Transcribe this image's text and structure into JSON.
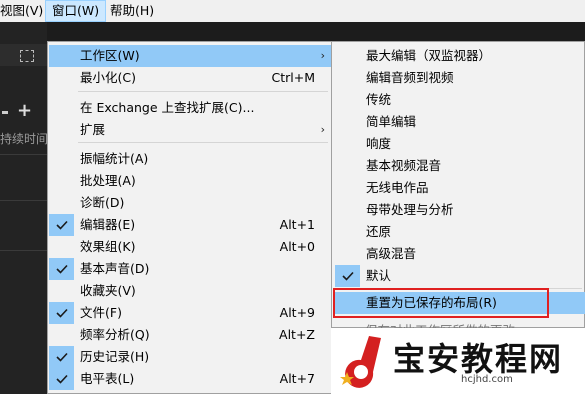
{
  "menubar": {
    "view": "视图(V)",
    "window": "窗口(W)",
    "help": "帮助(H)"
  },
  "background": {
    "duration_label": "持续时间"
  },
  "window_menu": {
    "items": [
      {
        "label": "工作区(W)",
        "shortcut": "",
        "submenu": true,
        "checked": false,
        "highlighted": true
      },
      {
        "label": "最小化(C)",
        "shortcut": "Ctrl+M",
        "submenu": false,
        "checked": false
      },
      {
        "label": "在 Exchange 上查找扩展(C)...",
        "shortcut": "",
        "submenu": false,
        "checked": false
      },
      {
        "label": "扩展",
        "shortcut": "",
        "submenu": true,
        "checked": false
      },
      {
        "label": "振幅统计(A)",
        "shortcut": "",
        "submenu": false,
        "checked": false
      },
      {
        "label": "批处理(A)",
        "shortcut": "",
        "submenu": false,
        "checked": false
      },
      {
        "label": "诊断(D)",
        "shortcut": "",
        "submenu": false,
        "checked": false
      },
      {
        "label": "编辑器(E)",
        "shortcut": "Alt+1",
        "submenu": false,
        "checked": true
      },
      {
        "label": "效果组(K)",
        "shortcut": "Alt+0",
        "submenu": false,
        "checked": false
      },
      {
        "label": "基本声音(D)",
        "shortcut": "",
        "submenu": false,
        "checked": true
      },
      {
        "label": "收藏夹(V)",
        "shortcut": "",
        "submenu": false,
        "checked": false
      },
      {
        "label": "文件(F)",
        "shortcut": "Alt+9",
        "submenu": false,
        "checked": true
      },
      {
        "label": "频率分析(Q)",
        "shortcut": "Alt+Z",
        "submenu": false,
        "checked": false
      },
      {
        "label": "历史记录(H)",
        "shortcut": "",
        "submenu": false,
        "checked": true
      },
      {
        "label": "电平表(L)",
        "shortcut": "Alt+7",
        "submenu": false,
        "checked": true
      }
    ]
  },
  "workspace_menu": {
    "items": [
      {
        "label": "最大编辑（双监视器）",
        "checked": false
      },
      {
        "label": "编辑音频到视频",
        "checked": false
      },
      {
        "label": "传统",
        "checked": false
      },
      {
        "label": "简单编辑",
        "checked": false
      },
      {
        "label": "响度",
        "checked": false
      },
      {
        "label": "基本视频混音",
        "checked": false
      },
      {
        "label": "无线电作品",
        "checked": false
      },
      {
        "label": "母带处理与分析",
        "checked": false
      },
      {
        "label": "还原",
        "checked": false
      },
      {
        "label": "高级混音",
        "checked": false
      },
      {
        "label": "默认",
        "checked": true
      },
      {
        "label": "重置为已保存的布局(R)",
        "checked": false,
        "highlighted": true
      }
    ],
    "cut_off_item": "保存对此工作区所做的更改"
  },
  "watermark": {
    "title": "宝安教程网",
    "url": "hcjhd.com"
  }
}
